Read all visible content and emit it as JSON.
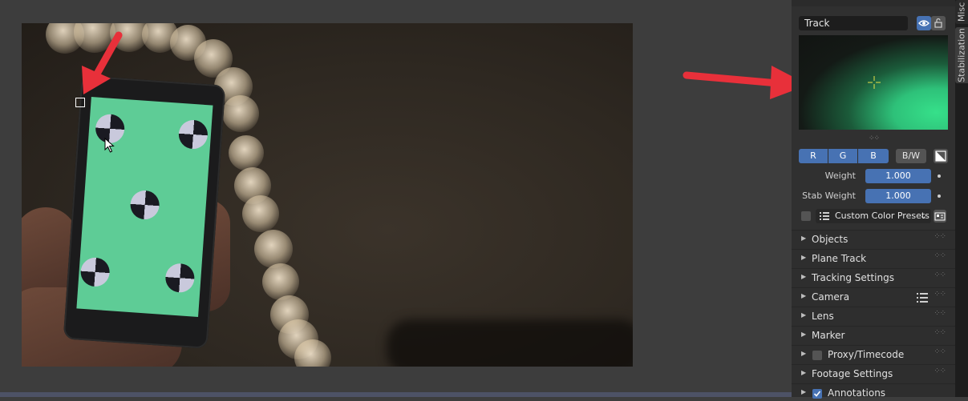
{
  "sidebar": {
    "track_name": "Track",
    "channels": [
      "R",
      "G",
      "B"
    ],
    "bw_label": "B/W",
    "weight_label": "Weight",
    "weight_value": "1.000",
    "stab_weight_label": "Stab Weight",
    "stab_weight_value": "1.000",
    "preset_label": "Custom Color Presets",
    "panels": {
      "objects": "Objects",
      "plane_track": "Plane Track",
      "tracking_settings": "Tracking Settings",
      "camera": "Camera",
      "lens": "Lens",
      "marker": "Marker",
      "proxy_timecode": "Proxy/Timecode",
      "footage_settings": "Footage Settings",
      "annotations": "Annotations"
    }
  },
  "tabs": {
    "misc": "Misc",
    "stabilization": "Stabilization"
  },
  "colors": {
    "accent": "#4772b3",
    "panel_bg": "#2e2e2e",
    "annotation_arrow": "#e8303a",
    "screen_green": "#5ecc96"
  }
}
